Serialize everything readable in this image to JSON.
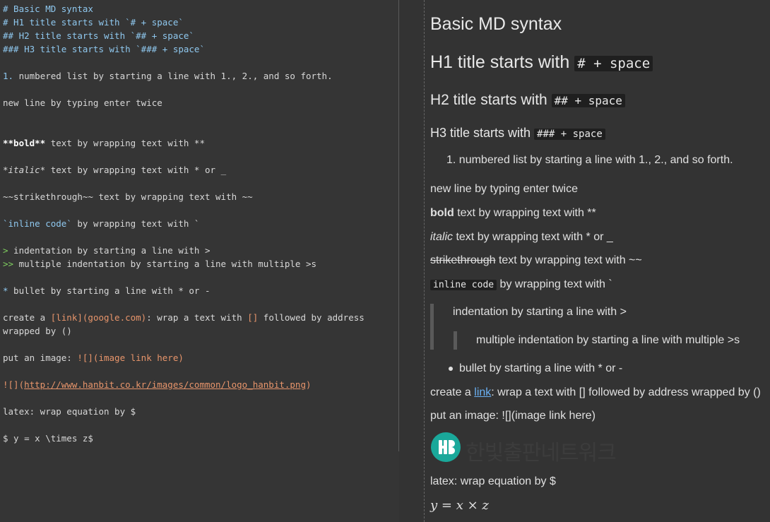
{
  "editor": {
    "lines": {
      "l1": "# Basic MD syntax",
      "l2": "# H1 title starts with `# + space`",
      "l3": "## H2 title starts with `## + space`",
      "l4": "### H3 title starts with `### + space`",
      "l5_num": "1.",
      "l5_rest": " numbered list by starting a line with 1., 2., and so forth.",
      "l6": "new line by typing enter twice",
      "l7_bold": "**bold**",
      "l7_rest": " text by wrapping text with **",
      "l8_italic": "*italic*",
      "l8_rest": " text by wrapping text with * or _",
      "l9": "~~strikethrough~~ text by wrapping text with ~~",
      "l10_code": "`inline code`",
      "l10_rest": " by wrapping text with `",
      "l11_mark": ">",
      "l11_rest": " indentation by starting a line with >",
      "l12_mark": ">>",
      "l12_rest": " multiple indentation by starting a line with multiple >s",
      "l13_mark": "*",
      "l13_rest": " bullet by starting a line with * or -",
      "l14_a": "create a ",
      "l14_link": "[link]",
      "l14_addr": "(google.com)",
      "l14_b": ": wrap a text with ",
      "l14_br": "[]",
      "l14_c": " followed by address wrapped by ()",
      "l15_a": "put an image: ",
      "l15_img": "![](image link here)",
      "l16_img": "![](",
      "l16_url": "http://www.hanbit.co.kr/images/common/logo_hanbit.png",
      "l16_end": ")",
      "l17": "latex: wrap equation by $",
      "l18": "$ y = x \\times z$"
    }
  },
  "preview": {
    "h_title": "Basic MD syntax",
    "h1_text": "H1 title starts with ",
    "h1_code": "# + space",
    "h2_text": "H2 title starts with ",
    "h2_code": "## + space",
    "h3_text": "H3 title starts with ",
    "h3_code": "### + space",
    "ol_item": "1. numbered list by starting a line with 1., 2., and so forth.",
    "newline": "new line by typing enter twice",
    "bold_word": "bold",
    "bold_rest": " text by wrapping text with **",
    "italic_word": "italic",
    "italic_rest": " text by wrapping text with * or _",
    "strike_word": "strikethrough",
    "strike_rest": " text by wrapping text with ~~",
    "code_word": "inline code",
    "code_rest": " by wrapping text with `",
    "quote1": "indentation by starting a line with >",
    "quote2": "multiple indentation by starting a line with multiple >s",
    "bullet": "bullet by starting a line with * or -",
    "link_a": "create a ",
    "link_word": "link",
    "link_b": ": wrap a text with [] followed by address wrapped by ()",
    "image_line": "put an image: ![](image link here)",
    "logo_text": "한빛출판네트워크",
    "latex_line": "latex: wrap equation by $",
    "math": "y = x × z"
  },
  "colors": {
    "background": "#333333",
    "heading_syntax": "#8fc8ef",
    "quote_syntax": "#7fcf5f",
    "link_syntax": "#e8956b",
    "link_rendered": "#6ab0f3",
    "logo_teal": "#1aa89a"
  }
}
